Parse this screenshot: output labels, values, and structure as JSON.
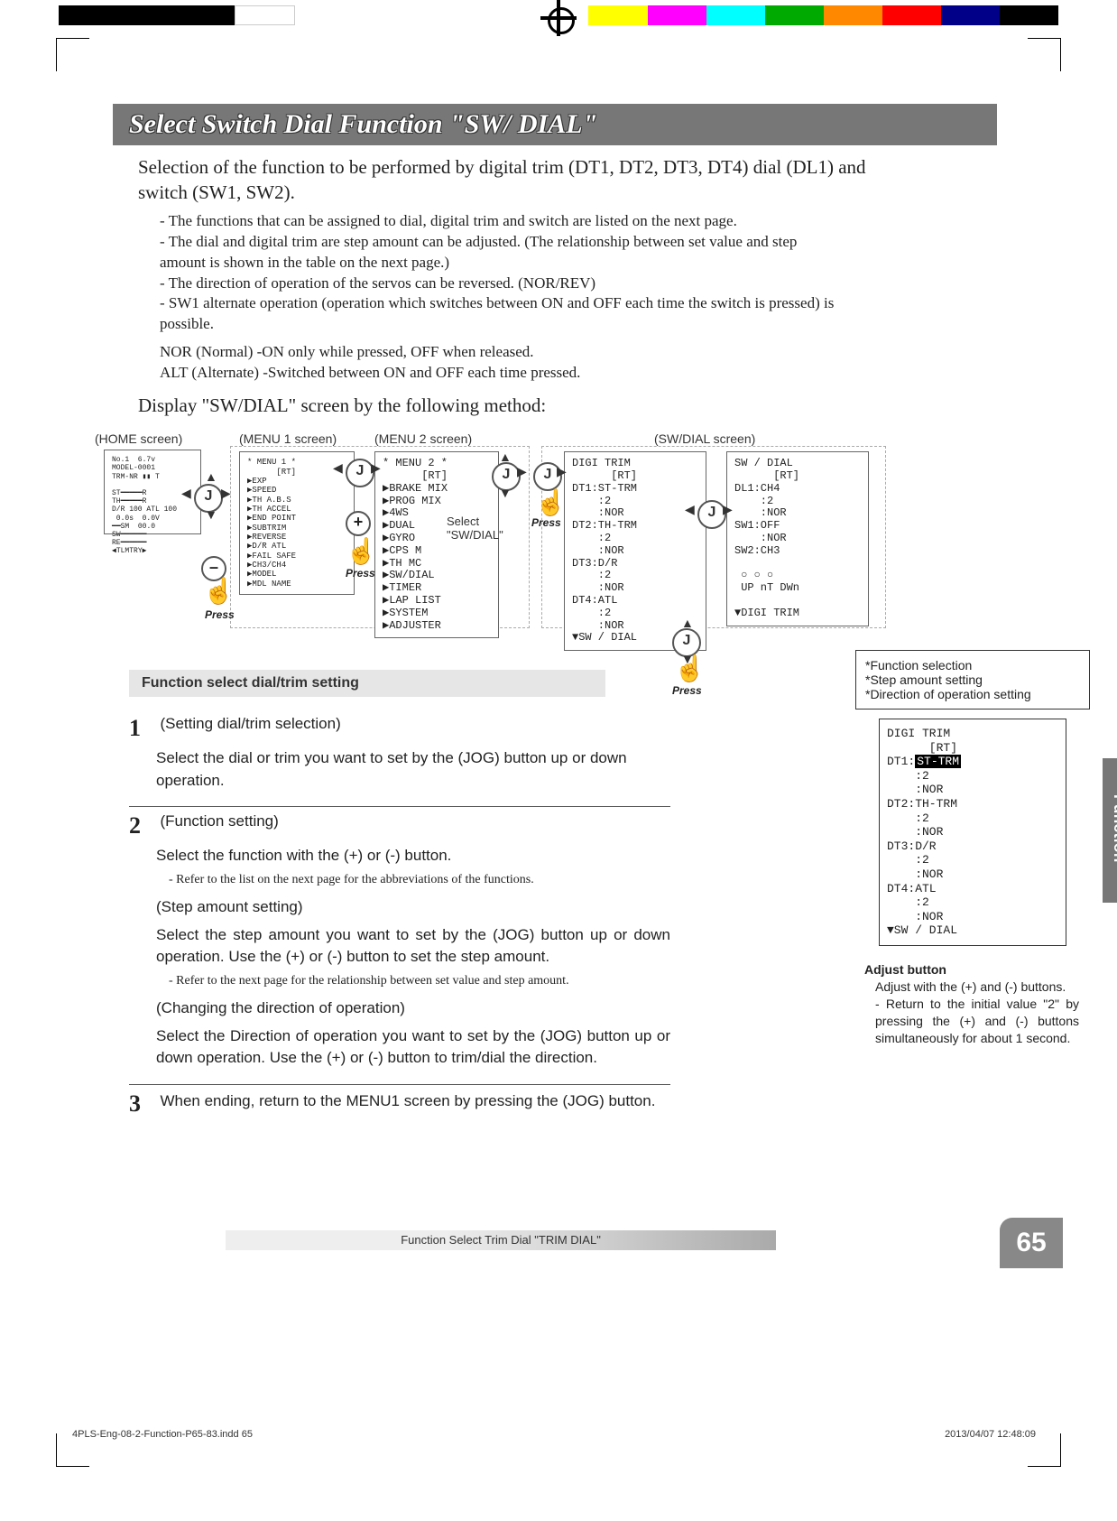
{
  "header": {
    "title": "Select Switch Dial Function  \"SW/ DIAL\""
  },
  "intro": "Selection of the function to be performed by digital trim (DT1, DT2, DT3, DT4) dial (DL1) and switch (SW1, SW2).",
  "bullets": [
    "- The functions that can be assigned to dial, digital trim  and switch are listed on the next page.",
    "- The dial and digital trim are step amount can be adjusted. (The relationship between set value and step amount is shown in the table on the next page.)",
    "- The direction of operation of the servos can be reversed. (NOR/REV)",
    "- SW1 alternate operation (operation which switches between ON and OFF each time the switch is pressed) is possible.",
    "NOR (Normal) -ON only while pressed, OFF when released.",
    "ALT (Alternate) -Switched between ON and OFF each time pressed."
  ],
  "display_line": "Display \"SW/DIAL\" screen by the following method:",
  "diagram": {
    "home_label": "(HOME screen)",
    "menu1_label": "(MENU 1 screen)",
    "menu2_label": "(MENU 2 screen)",
    "swdial_label": "(SW/DIAL screen)",
    "j": "J",
    "plus": "+",
    "minus": "–",
    "press": "Press",
    "select_hint": "Select\n\"SW/DIAL\"",
    "menu1_lines": "* MENU 1 *\n      [RT]\n▶EXP\n▶SPEED\n▶TH A.B.S\n▶TH ACCEL\n▶END POINT\n▶SUBTRIM\n▶REVERSE\n▶D/R ATL\n▶FAIL SAFE\n▶CH3/CH4\n▶MODEL\n▶MDL NAME",
    "menu2_lines": "* MENU 2 *\n      [RT]\n▶BRAKE MIX\n▶PROG MIX\n▶4WS\n▶DUAL\n▶GYRO\n▶CPS M\n▶TH MC\n▶SW/DIAL\n▶TIMER\n▶LAP LIST\n▶SYSTEM\n▶ADJUSTER",
    "digi_lines": "DIGI TRIM\n      [RT]\nDT1:ST-TRM\n    :2\n    :NOR\nDT2:TH-TRM\n    :2\n    :NOR\nDT3:D/R\n    :2\n    :NOR\nDT4:ATL\n    :2\n    :NOR\n▼SW / DIAL",
    "swdial_lines": "SW / DIAL\n      [RT]\nDL1:CH4\n    :2\n    :NOR\nSW1:OFF\n    :NOR\nSW2:CH3\n\n ○ ○ ○\n UP nT DWn\n\n▼DIGI TRIM"
  },
  "section_title": "Function select dial/trim setting",
  "steps": {
    "s1": {
      "num": "1",
      "sub": "(Setting dial/trim selection)",
      "body": "Select the dial or trim you want to set by the (JOG) button up or down operation."
    },
    "s2": {
      "num": "2",
      "sub": "(Function setting)",
      "body1": "Select the function with the (+) or (-) button.",
      "note1": "- Refer to the list on the next page for the abbreviations of the functions.",
      "sub2": "(Step amount setting)",
      "body2": "Select the step amount you want to set by the (JOG) button up or down operation. Use the (+) or (-) button to set the step amount.",
      "note2": "- Refer to the next page for the relationship between set value and step amount.",
      "sub3": "(Changing the direction of operation)",
      "body3": "Select the Direction of operation you want to set by the (JOG) button up or down operation. Use the (+) or (-) button to trim/dial the direction."
    },
    "s3": {
      "num": "3",
      "body": "When ending, return to the MENU1 screen by pressing the (JOG) button."
    }
  },
  "right": {
    "info1": "*Function selection",
    "info2": "*Step amount setting",
    "info3": "*Direction of operation setting",
    "lcd": "DIGI TRIM\n      [RT]\nDT1:ST-TRM\n    :2\n    :NOR\nDT2:TH-TRM\n    :2\n    :NOR\nDT3:D/R\n    :2\n    :NOR\nDT4:ATL\n    :2\n    :NOR\n▼SW / DIAL",
    "adjust_title": "Adjust button",
    "adjust_body1": "Adjust with the (+) and (-) buttons.",
    "adjust_body2": "- Return to the initial value \"2\" by pressing the (+) and (-) buttons simultaneously for about 1 second."
  },
  "sidetab": "Function",
  "footer": "Function Select Trim Dial  \"TRIM DIAL\"",
  "page_number": "65",
  "imprint_left": "4PLS-Eng-08-2-Function-P65-83.indd   65",
  "imprint_right": "2013/04/07   12:48:09",
  "colors": [
    "#fff",
    "#000",
    "#000",
    "#000",
    "#fff",
    "#fff",
    "#fff",
    "#fff",
    "#fff",
    "#fff",
    "#ff0",
    "#f0f",
    "#0ff",
    "#0a0",
    "#f80",
    "#f00",
    "#008",
    "#000",
    "#fff"
  ]
}
